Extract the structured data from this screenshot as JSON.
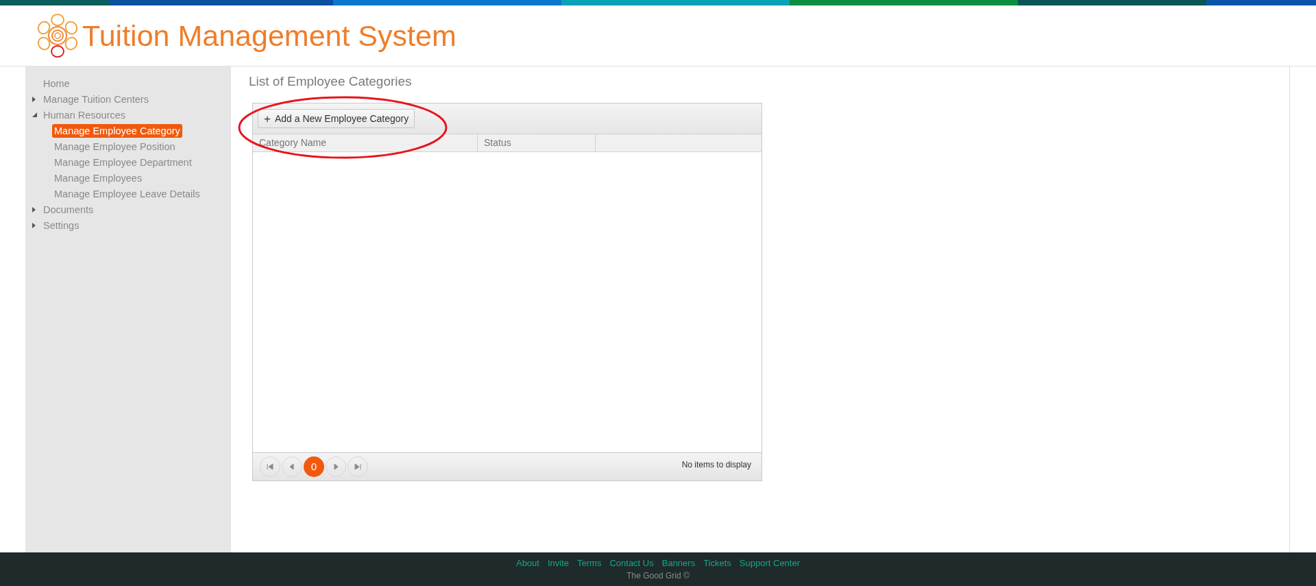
{
  "header": {
    "title": "Tuition Management System"
  },
  "sidebar": {
    "items": [
      {
        "label": "Home",
        "selected": false
      },
      {
        "label": "Manage Tuition Centers",
        "selected": false,
        "expanded": false
      },
      {
        "label": "Human Resources",
        "selected": false,
        "expanded": true,
        "children": [
          {
            "label": "Manage Employee Category",
            "selected": true
          },
          {
            "label": "Manage Employee Position",
            "selected": false
          },
          {
            "label": "Manage Employee Department",
            "selected": false
          },
          {
            "label": "Manage Employees",
            "selected": false
          },
          {
            "label": "Manage Employee Leave Details",
            "selected": false
          }
        ]
      },
      {
        "label": "Documents",
        "selected": false,
        "expanded": false
      },
      {
        "label": "Settings",
        "selected": false,
        "expanded": false
      }
    ]
  },
  "page_title": "List of Employee Categories",
  "grid": {
    "toolbar_button": {
      "icon": "+",
      "label": "Add a New Employee Category"
    },
    "columns": [
      "Category Name",
      "Status"
    ],
    "pager": {
      "buttons": [
        {
          "kind": "first"
        },
        {
          "kind": "prev"
        },
        {
          "kind": "page",
          "label": "0",
          "selected": true
        },
        {
          "kind": "next"
        },
        {
          "kind": "last"
        }
      ],
      "info": "No items to display"
    }
  },
  "footer": {
    "links": [
      "About",
      "Invite",
      "Terms",
      "Contact Us",
      "Banners",
      "Tickets",
      "Support Center"
    ],
    "copyright": "The Good Grid ©"
  }
}
